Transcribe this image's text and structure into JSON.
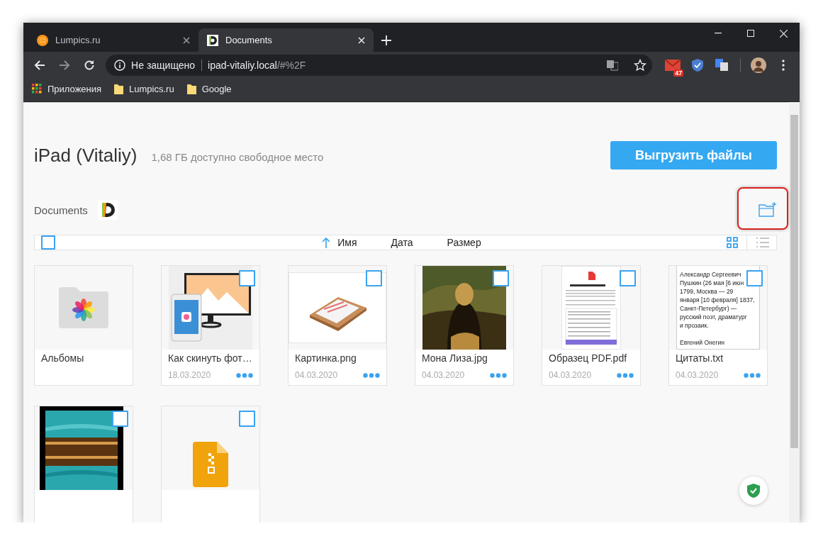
{
  "browser": {
    "tabs": [
      {
        "title": "Lumpics.ru",
        "selected": false,
        "kind": "orange"
      },
      {
        "title": "Documents",
        "selected": true,
        "kind": "documents"
      }
    ],
    "address": {
      "security": "Не защищено",
      "host": "ipad-vitaliy.local",
      "path": "/#%2F"
    },
    "extension_badge": "47",
    "bookmarks": [
      {
        "label": "Приложения",
        "kind": "apps"
      },
      {
        "label": "Lumpics.ru",
        "kind": "folder"
      },
      {
        "label": "Google",
        "kind": "folder"
      }
    ]
  },
  "page": {
    "device_name": "iPad (Vitaliy)",
    "free_space": "1,68 ГБ доступно свободное место",
    "upload_button": "Выгрузить файлы",
    "breadcrumb": "Documents",
    "select_all": {
      "checked": false
    },
    "sort_columns": [
      {
        "label": "Имя",
        "selected": true
      },
      {
        "label": "Дата",
        "selected": false
      },
      {
        "label": "Размер",
        "selected": false
      }
    ],
    "views": [
      {
        "kind": "grid",
        "selected": true
      },
      {
        "kind": "list",
        "selected": false
      }
    ],
    "files": [
      {
        "name": "Альбомы",
        "kind": "folder"
      },
      {
        "name": "Как скинуть фот…",
        "date": "18.03.2020",
        "kind": "illustration",
        "checked": false
      },
      {
        "name": "Картинка.png",
        "date": "04.03.2020",
        "kind": "tray",
        "checked": false
      },
      {
        "name": "Мона Лиза.jpg",
        "date": "04.03.2020",
        "kind": "picture",
        "checked": false
      },
      {
        "name": "Образец PDF.pdf",
        "date": "04.03.2020",
        "kind": "pdf",
        "checked": false
      },
      {
        "name": "Цитаты.txt",
        "date": "04.03.2020",
        "kind": "text",
        "checked": false,
        "preview": [
          "Александр Сергеевич",
          "Пушкин (26 мая [6 июн",
          "1799, Москва — 29",
          "января [10 февраля] 1837,",
          "Санкт-Петербург) —",
          "русский поэт, драматург",
          "и прозаик.",
          "Евгений Онегин"
        ]
      },
      {
        "kind": "picture",
        "checked": false
      },
      {
        "kind": "archive",
        "checked": false
      }
    ]
  }
}
